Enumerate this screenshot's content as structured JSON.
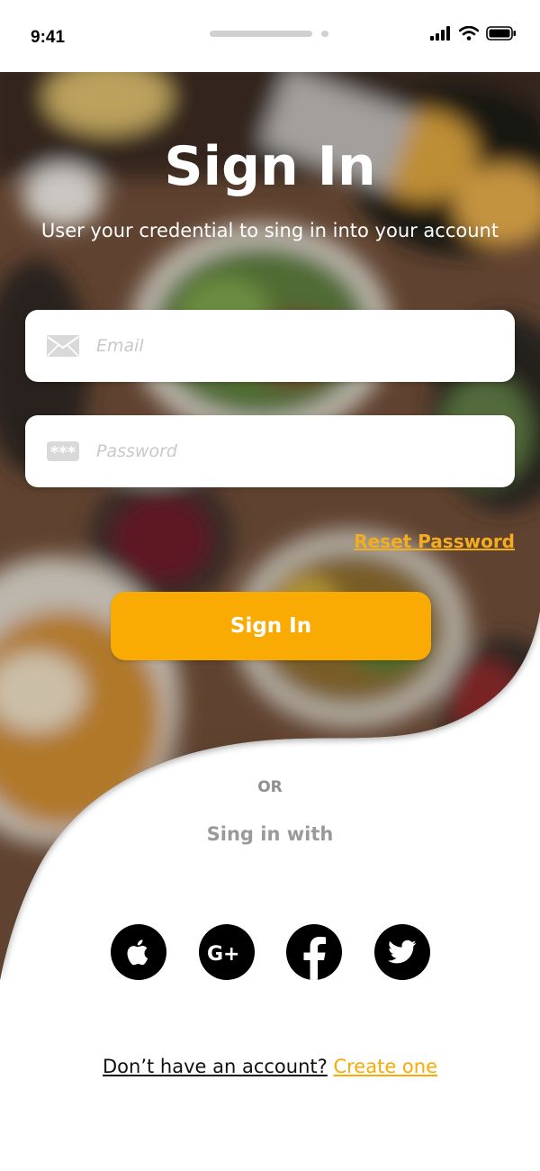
{
  "status_bar": {
    "time": "9:41"
  },
  "header": {
    "title": "Sign In",
    "subtitle": "User your credential to sing in into your account"
  },
  "form": {
    "email_placeholder": "Email",
    "password_placeholder": "Password",
    "email_icon": "envelope-icon",
    "password_icon": "password-dots-icon"
  },
  "reset_label": "Reset Password",
  "signin_label": "Sign In",
  "divider_label": "OR",
  "social": {
    "label": "Sing in with",
    "items": [
      "apple-icon",
      "google-plus-icon",
      "facebook-icon",
      "twitter-icon"
    ]
  },
  "footer": {
    "question": "Don’t have an account?",
    "link": "Create one"
  },
  "colors": {
    "accent": "#f9ab04",
    "link": "#f3ad1f",
    "muted": "#9a9a9a"
  }
}
